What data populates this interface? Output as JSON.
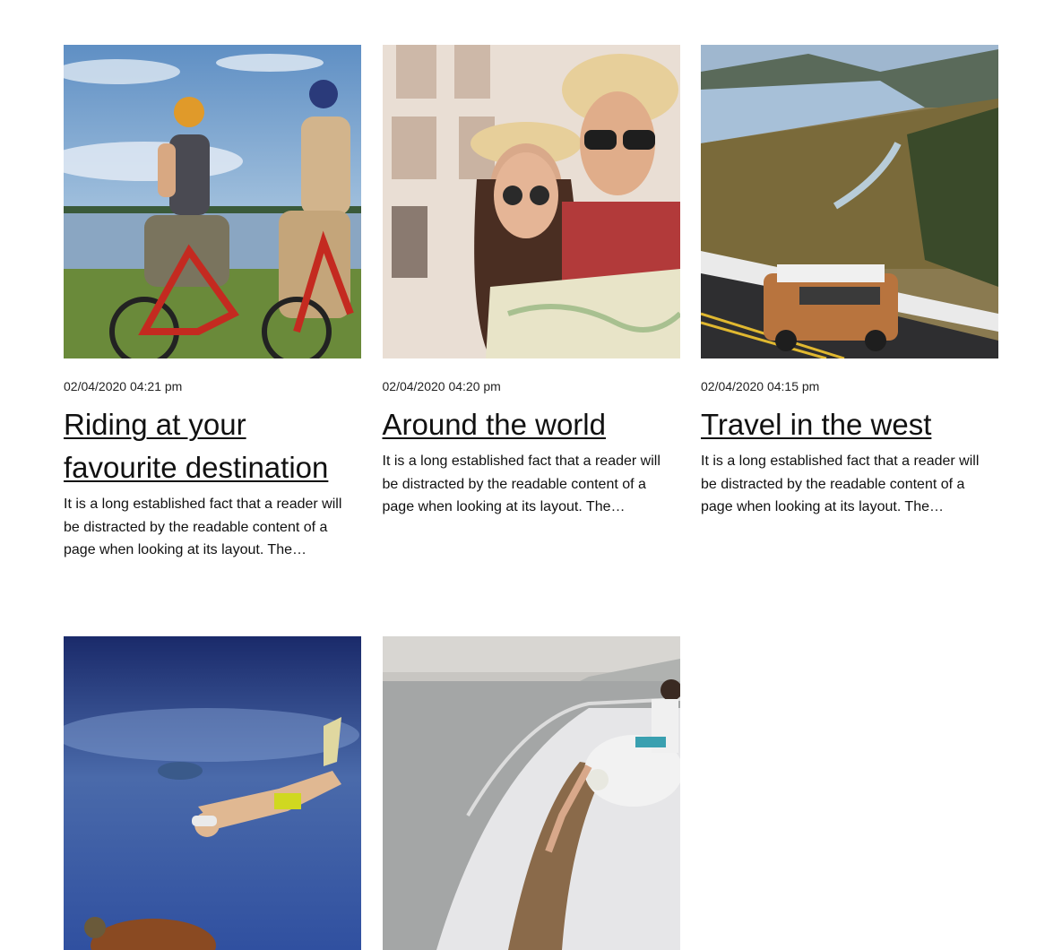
{
  "posts": [
    {
      "image_alt": "two women riding bicycles by a lake",
      "date": "02/04/2020 04:21 pm",
      "title": "Riding at your favourite destination",
      "excerpt": "It is a long established fact that a reader will be distracted by the readable content of a page when looking at its layout. The…"
    },
    {
      "image_alt": "smiling couple in sun hats holding a map",
      "date": "02/04/2020 04:20 pm",
      "title": "Around the world",
      "excerpt": "It is a long established fact that a reader will be distracted by the readable content of a page when looking at its layout. The…"
    },
    {
      "image_alt": "orange van driving along a river gorge road",
      "date": "02/04/2020 04:15 pm",
      "title": "Travel in the west",
      "excerpt": "It is a long established fact that a reader will be distracted by the readable content of a page when looking at its layout. The…"
    },
    {
      "image_alt": "snorkeler swimming underwater near a turtle"
    },
    {
      "image_alt": "woman in white dress sitting on a yacht bow"
    }
  ],
  "colors": {
    "background": "#ffffff",
    "text": "#111111"
  }
}
